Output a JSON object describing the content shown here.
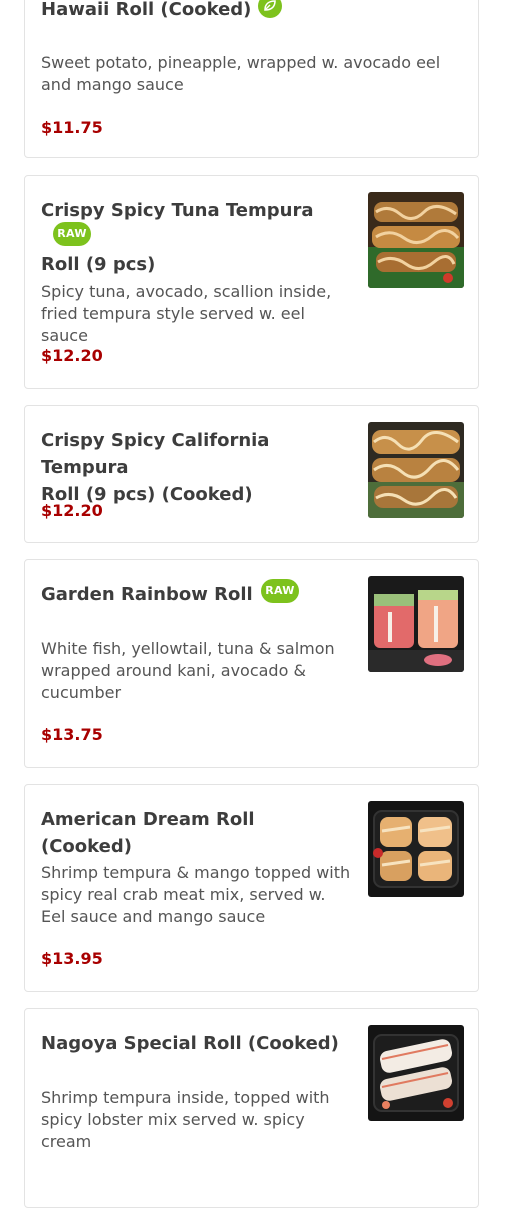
{
  "items": [
    {
      "name": "Hawaii Roll (Cooked)",
      "description": "Sweet potato, pineapple, wrapped w. avocado eel and mango sauce",
      "price": "$11.75",
      "badge": "leaf-icon"
    },
    {
      "name_line1": "Crispy Spicy Tuna Tempura",
      "name_line2": "Roll (9 pcs)",
      "badge_text": "RAW",
      "description": "Spicy tuna, avocado, scallion inside, fried tempura style served w. eel sauce",
      "price": "$12.20"
    },
    {
      "name_line1": "Crispy Spicy California Tempura",
      "name_line2": "Roll (9 pcs) (Cooked)",
      "price": "$12.20"
    },
    {
      "name": "Garden Rainbow Roll",
      "badge_text": "RAW",
      "description": "White fish, yellowtail, tuna & salmon wrapped around kani, avocado & cucumber",
      "price": "$13.75"
    },
    {
      "name": "American Dream Roll (Cooked)",
      "description": "Shrimp tempura & mango topped with spicy real crab meat mix, served w. Eel sauce and mango sauce",
      "price": "$13.95"
    },
    {
      "name": "Nagoya Special Roll (Cooked)",
      "description": "Shrimp tempura inside, topped with spicy lobster mix served w. spicy cream"
    }
  ],
  "colors": {
    "price": "#a80000",
    "badge": "#7dc21d",
    "border": "#e3e3e3"
  }
}
